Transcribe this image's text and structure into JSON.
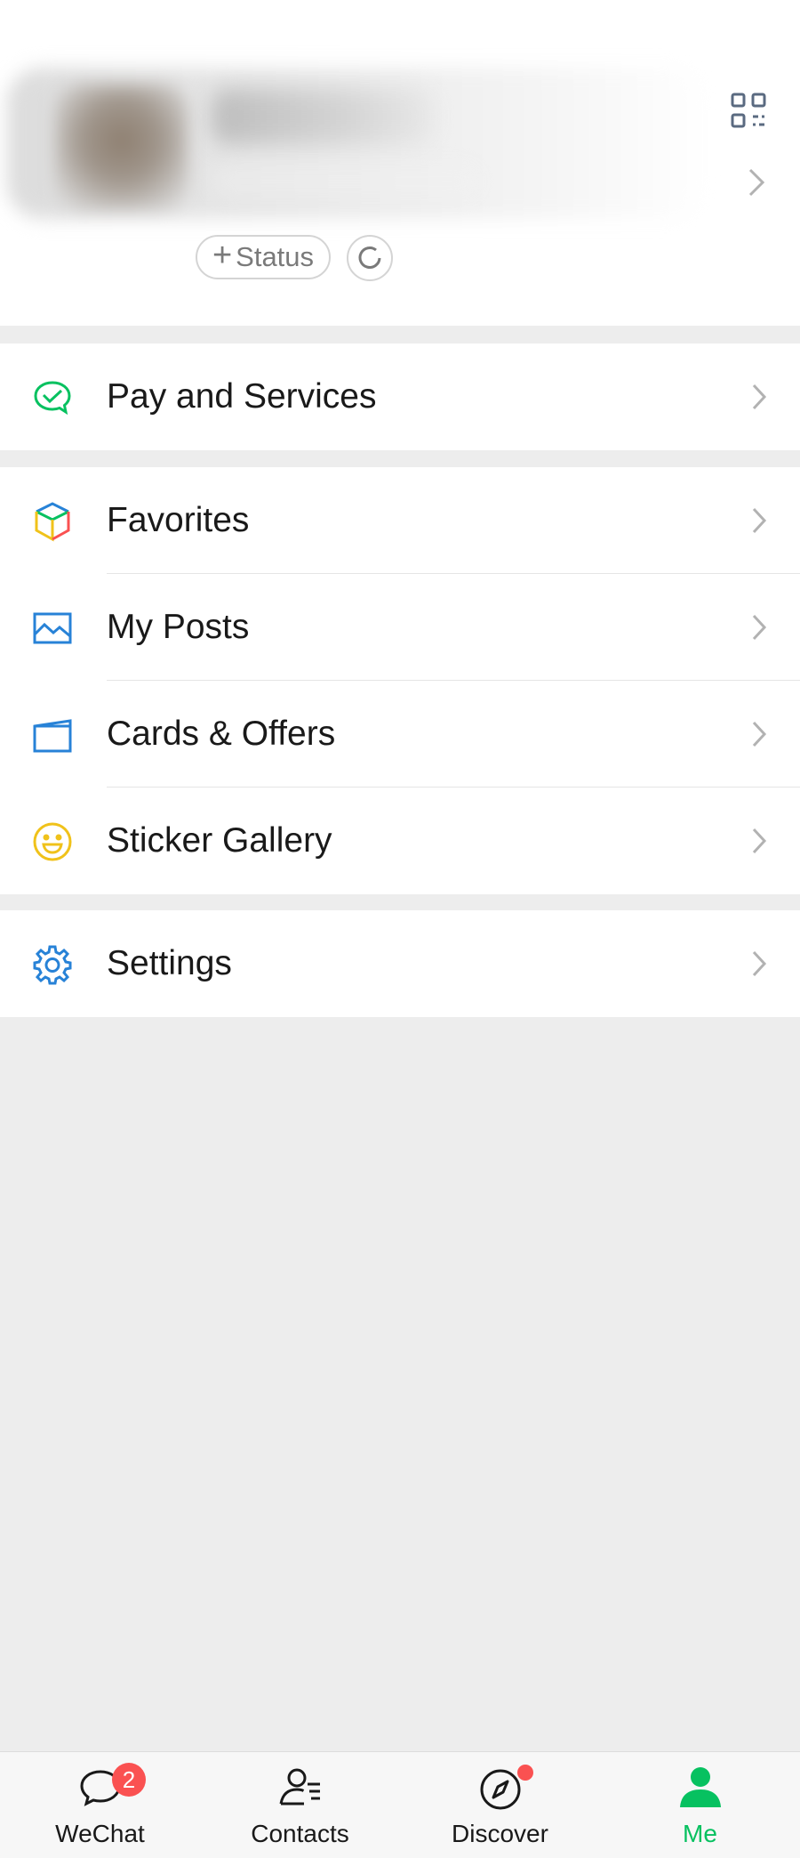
{
  "profile": {
    "status_label": "Status",
    "status_plus": "+"
  },
  "menu": {
    "pay": {
      "label": "Pay and Services",
      "icon": "pay-icon",
      "color": "#07c160"
    },
    "group2": [
      {
        "label": "Favorites",
        "icon": "favorites-cube-icon"
      },
      {
        "label": "My Posts",
        "icon": "posts-image-icon",
        "color": "#2782d7"
      },
      {
        "label": "Cards & Offers",
        "icon": "card-icon",
        "color": "#2782d7"
      },
      {
        "label": "Sticker Gallery",
        "icon": "smiley-icon",
        "color": "#f0c21a"
      }
    ],
    "settings": {
      "label": "Settings",
      "icon": "gear-icon",
      "color": "#2782d7"
    }
  },
  "tabbar": {
    "tabs": [
      {
        "label": "WeChat",
        "icon": "chat-bubble-icon",
        "badge": "2"
      },
      {
        "label": "Contacts",
        "icon": "contacts-icon"
      },
      {
        "label": "Discover",
        "icon": "compass-icon"
      },
      {
        "label": "Me",
        "icon": "person-icon",
        "active": true
      }
    ],
    "active_color": "#07c160",
    "badge_color": "#fa5151"
  }
}
